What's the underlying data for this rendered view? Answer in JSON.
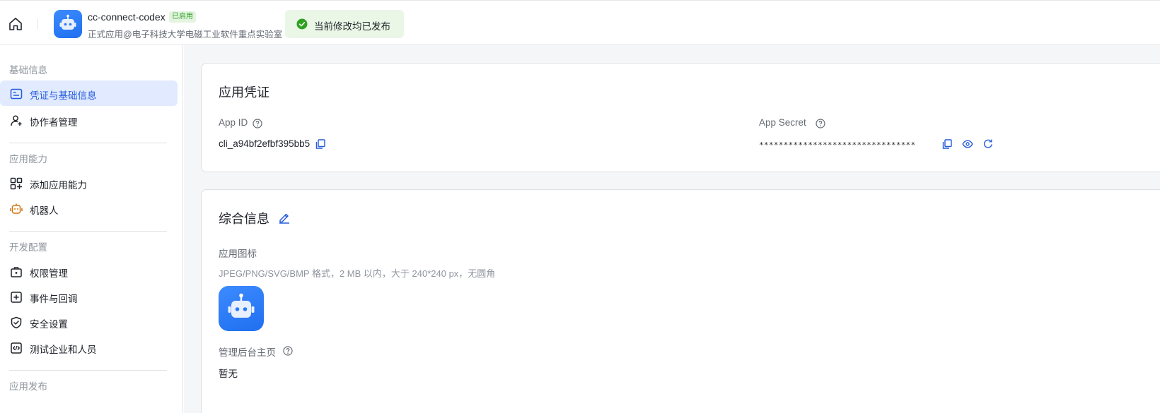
{
  "header": {
    "app_name": "cc-connect-codex",
    "status_badge": "已启用",
    "org": "正式应用@电子科技大学电磁工业软件重点实验室",
    "publish_status": "当前修改均已发布"
  },
  "sidebar": {
    "groups": [
      {
        "title": "基础信息",
        "items": [
          {
            "label": "凭证与基础信息",
            "active": true
          },
          {
            "label": "协作者管理"
          }
        ]
      },
      {
        "title": "应用能力",
        "items": [
          {
            "label": "添加应用能力"
          },
          {
            "label": "机器人"
          }
        ]
      },
      {
        "title": "开发配置",
        "items": [
          {
            "label": "权限管理"
          },
          {
            "label": "事件与回调"
          },
          {
            "label": "安全设置"
          },
          {
            "label": "测试企业和人员"
          }
        ]
      },
      {
        "title": "应用发布",
        "items": []
      }
    ]
  },
  "credentials": {
    "title": "应用凭证",
    "app_id_label": "App ID",
    "app_id": "cli_a94bf2efbf395bb5",
    "app_secret_label": "App Secret",
    "app_secret": "********************************"
  },
  "general": {
    "title": "综合信息",
    "icon_label": "应用图标",
    "icon_hint": "JPEG/PNG/SVG/BMP 格式，2 MB 以内，大于 240*240 px，无圆角",
    "homepage_label": "管理后台主页",
    "homepage_value": "暂无"
  },
  "colors": {
    "accent": "#245bdb",
    "active_bg": "#e1eaff",
    "success": "#2ea121",
    "toast_bg": "#eaf7e7"
  }
}
